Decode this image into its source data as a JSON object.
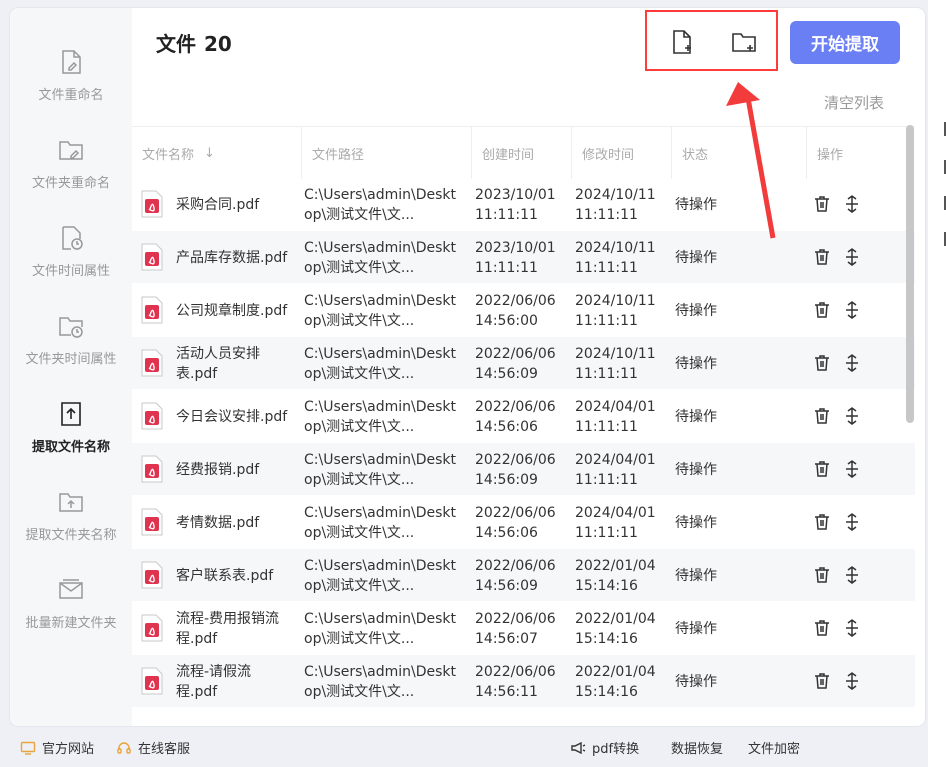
{
  "sidebar": {
    "items": [
      {
        "label": "文件重命名",
        "icon": "file-edit-icon"
      },
      {
        "label": "文件夹重命名",
        "icon": "folder-edit-icon"
      },
      {
        "label": "文件时间属性",
        "icon": "file-clock-icon"
      },
      {
        "label": "文件夹时间属性",
        "icon": "folder-clock-icon"
      },
      {
        "label": "提取文件名称",
        "icon": "file-upload-icon"
      },
      {
        "label": "提取文件夹名称",
        "icon": "folder-upload-icon"
      },
      {
        "label": "批量新建文件夹",
        "icon": "mail-folder-icon"
      }
    ],
    "active_index": 4
  },
  "header": {
    "title": "文件",
    "count": "20",
    "add_file_icon": "add-file-icon",
    "add_folder_icon": "add-folder-icon",
    "start_label": "开始提取",
    "clear_label": "清空列表"
  },
  "table": {
    "columns": [
      "文件名称",
      "文件路径",
      "创建时间",
      "修改时间",
      "状态",
      "操作"
    ],
    "sort_icon": "↓",
    "rows": [
      {
        "name": "采购合同.pdf",
        "path": "C:\\Users\\admin\\Desktop\\测试文件\\文...",
        "created": "2023/10/01 11:11:11",
        "modified": "2024/10/11 11:11:11",
        "status": "待操作"
      },
      {
        "name": "产品库存数据.pdf",
        "path": "C:\\Users\\admin\\Desktop\\测试文件\\文...",
        "created": "2023/10/01 11:11:11",
        "modified": "2024/10/11 11:11:11",
        "status": "待操作"
      },
      {
        "name": "公司规章制度.pdf",
        "path": "C:\\Users\\admin\\Desktop\\测试文件\\文...",
        "created": "2022/06/06 14:56:00",
        "modified": "2024/10/11 11:11:11",
        "status": "待操作"
      },
      {
        "name": "活动人员安排表.pdf",
        "path": "C:\\Users\\admin\\Desktop\\测试文件\\文...",
        "created": "2022/06/06 14:56:09",
        "modified": "2024/10/11 11:11:11",
        "status": "待操作"
      },
      {
        "name": "今日会议安排.pdf",
        "path": "C:\\Users\\admin\\Desktop\\测试文件\\文...",
        "created": "2022/06/06 14:56:06",
        "modified": "2024/04/01 11:11:11",
        "status": "待操作"
      },
      {
        "name": "经费报销.pdf",
        "path": "C:\\Users\\admin\\Desktop\\测试文件\\文...",
        "created": "2022/06/06 14:56:09",
        "modified": "2024/04/01 11:11:11",
        "status": "待操作"
      },
      {
        "name": "考情数据.pdf",
        "path": "C:\\Users\\admin\\Desktop\\测试文件\\文...",
        "created": "2022/06/06 14:56:06",
        "modified": "2024/04/01 11:11:11",
        "status": "待操作"
      },
      {
        "name": "客户联系表.pdf",
        "path": "C:\\Users\\admin\\Desktop\\测试文件\\文...",
        "created": "2022/06/06 14:56:09",
        "modified": "2022/01/04 15:14:16",
        "status": "待操作"
      },
      {
        "name": "流程-费用报销流程.pdf",
        "path": "C:\\Users\\admin\\Desktop\\测试文件\\文...",
        "created": "2022/06/06 14:56:07",
        "modified": "2022/01/04 15:14:16",
        "status": "待操作"
      },
      {
        "name": "流程-请假流程.pdf",
        "path": "C:\\Users\\admin\\Desktop\\测试文件\\文...",
        "created": "2022/06/06 14:56:11",
        "modified": "2022/01/04 15:14:16",
        "status": "待操作"
      }
    ]
  },
  "bottom_bar": {
    "website": "官方网站",
    "support": "在线客服",
    "pdf_convert": "pdf转换",
    "data_recovery": "数据恢复",
    "file_encrypt": "文件加密"
  },
  "colors": {
    "accent": "#6b7ff5",
    "highlight": "#ff3b3b",
    "pdf_red": "#e0334f"
  }
}
